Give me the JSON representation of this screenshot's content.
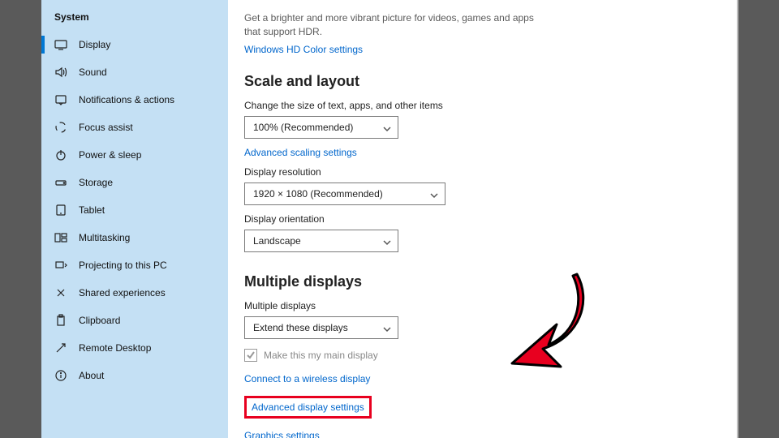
{
  "sidebar": {
    "title": "System",
    "items": [
      {
        "label": "Display",
        "icon": "display",
        "selected": true
      },
      {
        "label": "Sound",
        "icon": "sound"
      },
      {
        "label": "Notifications & actions",
        "icon": "notifications"
      },
      {
        "label": "Focus assist",
        "icon": "focus"
      },
      {
        "label": "Power & sleep",
        "icon": "power"
      },
      {
        "label": "Storage",
        "icon": "storage"
      },
      {
        "label": "Tablet",
        "icon": "tablet"
      },
      {
        "label": "Multitasking",
        "icon": "multitasking"
      },
      {
        "label": "Projecting to this PC",
        "icon": "projecting"
      },
      {
        "label": "Shared experiences",
        "icon": "shared"
      },
      {
        "label": "Clipboard",
        "icon": "clipboard"
      },
      {
        "label": "Remote Desktop",
        "icon": "remote"
      },
      {
        "label": "About",
        "icon": "about"
      }
    ]
  },
  "hdr": {
    "desc": "Get a brighter and more vibrant picture for videos, games and apps that support HDR.",
    "link": "Windows HD Color settings"
  },
  "scale": {
    "title": "Scale and layout",
    "size_label": "Change the size of text, apps, and other items",
    "size_value": "100% (Recommended)",
    "adv_link": "Advanced scaling settings",
    "res_label": "Display resolution",
    "res_value": "1920 × 1080 (Recommended)",
    "orient_label": "Display orientation",
    "orient_value": "Landscape"
  },
  "multi": {
    "title": "Multiple displays",
    "mode_label": "Multiple displays",
    "mode_value": "Extend these displays",
    "main_check": "Make this my main display",
    "connect_link": "Connect to a wireless display",
    "adv_link": "Advanced display settings",
    "graphics_link": "Graphics settings"
  }
}
